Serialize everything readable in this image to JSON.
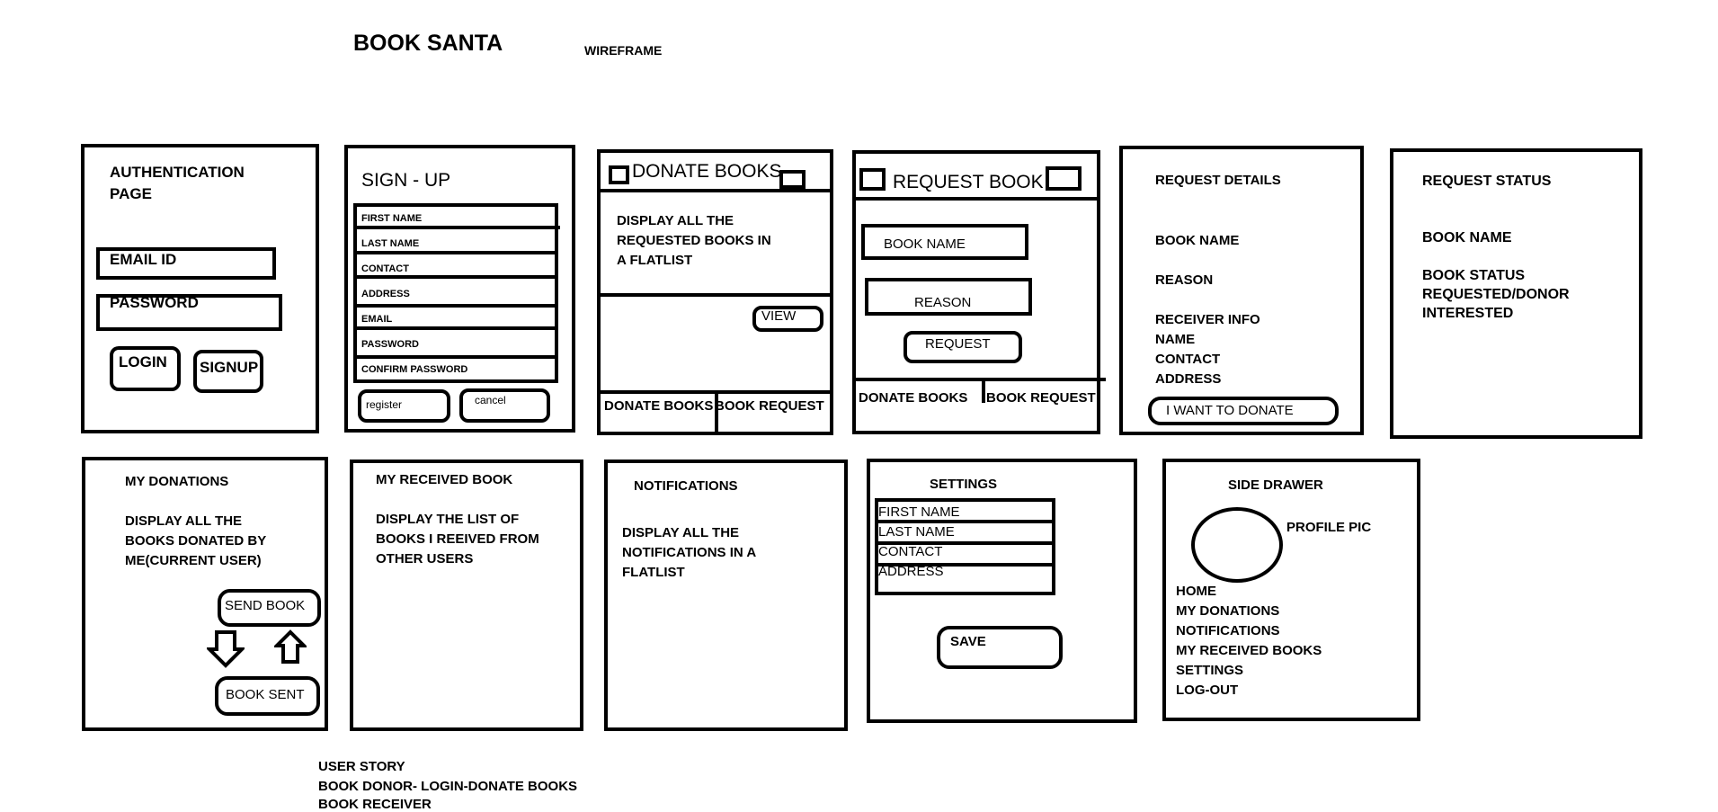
{
  "header": {
    "title": "BOOK SANTA",
    "subtitle": "WIREFRAME"
  },
  "auth": {
    "title_line1": "AUTHENTICATION",
    "title_line2": "PAGE",
    "email_label": "EMAIL ID",
    "password_label": "PASSWORD",
    "login_label": "LOGIN",
    "signup_label": "SIGNUP"
  },
  "signup": {
    "title": "SIGN - UP",
    "fields": [
      "FIRST NAME",
      "LAST NAME",
      "CONTACT",
      "ADDRESS",
      "EMAIL",
      "PASSWORD",
      "CONFIRM PASSWORD"
    ],
    "register_label": "register",
    "cancel_label": "cancel"
  },
  "donate": {
    "title": "DONATE BOOKS",
    "body_line1": "DISPLAY ALL THE",
    "body_line2": "REQUESTED BOOKS IN",
    "body_line3": "A FLATLIST",
    "view_label": "VIEW",
    "tab_donate": "DONATE BOOKS",
    "tab_request": "BOOK REQUEST"
  },
  "request_book": {
    "title": "REQUEST BOOK",
    "book_name_label": "BOOK NAME",
    "reason_label": "REASON",
    "request_label": "REQUEST",
    "tab_donate": "DONATE BOOKS",
    "tab_request": "BOOK REQUEST"
  },
  "request_details": {
    "title": "REQUEST DETAILS",
    "book_name": "BOOK NAME",
    "reason": "REASON",
    "receiver_info": "RECEIVER INFO",
    "name": "NAME",
    "contact": "CONTACT",
    "address": "ADDRESS",
    "donate_label": "I WANT TO DONATE"
  },
  "request_status": {
    "title": "REQUEST STATUS",
    "book_name": "BOOK NAME",
    "status_line1": "BOOK STATUS",
    "status_line2": "REQUESTED/DONOR",
    "status_line3": "INTERESTED"
  },
  "my_donations": {
    "title": "MY DONATIONS",
    "body_line1": "DISPLAY ALL THE",
    "body_line2": "BOOKS DONATED BY",
    "body_line3": "ME(CURRENT USER)",
    "send_label": "SEND BOOK",
    "sent_label": "BOOK SENT"
  },
  "received": {
    "title": "MY RECEIVED BOOK",
    "body_line1": "DISPLAY THE LIST OF",
    "body_line2": "BOOKS I REEIVED FROM",
    "body_line3": "OTHER USERS"
  },
  "notifications": {
    "title": "NOTIFICATIONS",
    "body_line1": "DISPLAY ALL THE",
    "body_line2": "NOTIFICATIONS IN A",
    "body_line3": "FLATLIST"
  },
  "settings": {
    "title": "SETTINGS",
    "fields": [
      "FIRST NAME",
      "LAST NAME",
      "CONTACT",
      "ADDRESS"
    ],
    "save_label": "SAVE"
  },
  "drawer": {
    "title": "SIDE DRAWER",
    "profile_label": "PROFILE PIC",
    "items": [
      "HOME",
      "MY DONATIONS",
      "NOTIFICATIONS",
      "MY RECEIVED BOOKS",
      "SETTINGS",
      "LOG-OUT"
    ]
  },
  "user_story": {
    "line1": "USER STORY",
    "line2": "BOOK DONOR- LOGIN-DONATE BOOKS",
    "line3": "BOOK RECEIVER"
  },
  "icons": {
    "down_arrow": "down-arrow-icon",
    "up_arrow": "up-arrow-icon"
  }
}
